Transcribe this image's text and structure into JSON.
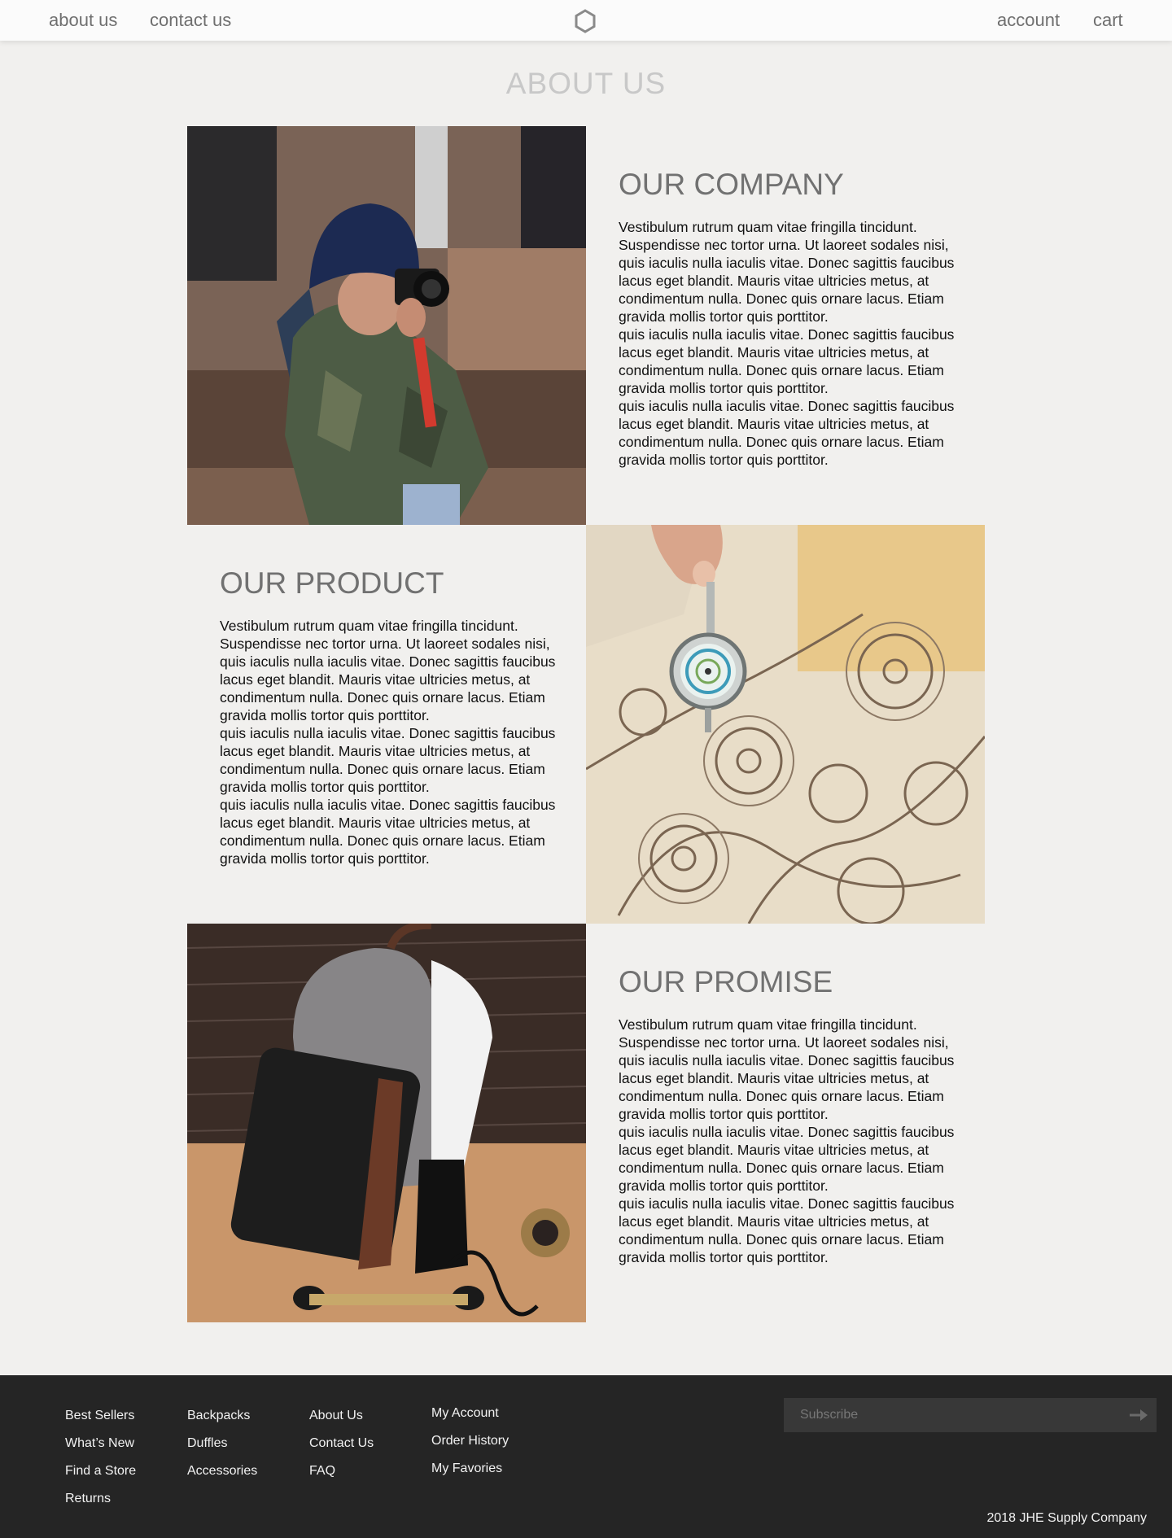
{
  "nav": {
    "about": "about us",
    "contact": "contact us",
    "account": "account",
    "cart": "cart",
    "logo_icon": "hexagon-logo-icon"
  },
  "page_title": "ABOUT  US",
  "sections": [
    {
      "heading": "OUR COMPANY",
      "body": "Vestibulum rutrum quam vitae fringilla tincidunt. Suspendisse nec tortor urna. Ut laoreet sodales nisi, quis iaculis nulla iaculis vitae. Donec sagittis faucibus lacus eget blandit. Mauris vitae ultricies metus, at condimentum nulla. Donec quis ornare lacus. Etiam gravida mollis tortor quis porttitor.\nquis iaculis nulla iaculis vitae. Donec sagittis faucibus lacus eget blandit. Mauris vitae ultricies metus, at condimentum nulla. Donec quis ornare lacus. Etiam gravida mollis tortor quis porttitor.\nquis iaculis nulla iaculis vitae. Donec sagittis faucibus lacus eget blandit. Mauris vitae ultricies metus, at condimentum nulla. Donec quis ornare lacus. Etiam gravida mollis tortor quis porttitor."
    },
    {
      "heading": "OUR PRODUCT",
      "body": "Vestibulum rutrum quam vitae fringilla tincidunt. Suspendisse nec tortor urna. Ut laoreet sodales nisi, quis iaculis nulla iaculis vitae. Donec sagittis faucibus lacus eget blandit. Mauris vitae ultricies metus, at condimentum nulla. Donec quis ornare lacus. Etiam gravida mollis tortor quis porttitor.\nquis iaculis nulla iaculis vitae. Donec sagittis faucibus lacus eget blandit. Mauris vitae ultricies metus, at condimentum nulla. Donec quis ornare lacus. Etiam gravida mollis tortor quis porttitor.\nquis iaculis nulla iaculis vitae. Donec sagittis faucibus lacus eget blandit. Mauris vitae ultricies metus, at condimentum nulla. Donec quis ornare lacus. Etiam gravida mollis tortor quis porttitor."
    },
    {
      "heading": "OUR PROMISE",
      "body": "Vestibulum rutrum quam vitae fringilla tincidunt. Suspendisse nec tortor urna. Ut laoreet sodales nisi, quis iaculis nulla iaculis vitae. Donec sagittis faucibus lacus eget blandit. Mauris vitae ultricies metus, at condimentum nulla. Donec quis ornare lacus. Etiam gravida mollis tortor quis porttitor.\nquis iaculis nulla iaculis vitae. Donec sagittis faucibus lacus eget blandit. Mauris vitae ultricies metus, at condimentum nulla. Donec quis ornare lacus. Etiam gravida mollis tortor quis porttitor.\nquis iaculis nulla iaculis vitae. Donec sagittis faucibus lacus eget blandit. Mauris vitae ultricies metus, at condimentum nulla. Donec quis ornare lacus. Etiam gravida mollis tortor quis porttitor."
    }
  ],
  "footer": {
    "col1": [
      "Best Sellers",
      "What’s New",
      "Find a Store",
      "Returns"
    ],
    "col2": [
      "Backpacks",
      "Duffles",
      "Accessories"
    ],
    "col3": [
      "About Us",
      "Contact Us",
      "FAQ"
    ],
    "col4": [
      "My Account",
      "Order History",
      "My Favories"
    ],
    "subscribe_placeholder": "Subscribe",
    "subscribe_icon": "arrow-right-icon",
    "copyright": "2018 JHE Supply Company"
  },
  "colors": {
    "background": "#f1f0ee",
    "nav_bg": "#fbfbfb",
    "footer_bg": "#252525",
    "heading": "#717171",
    "title": "#c8c8c8"
  }
}
